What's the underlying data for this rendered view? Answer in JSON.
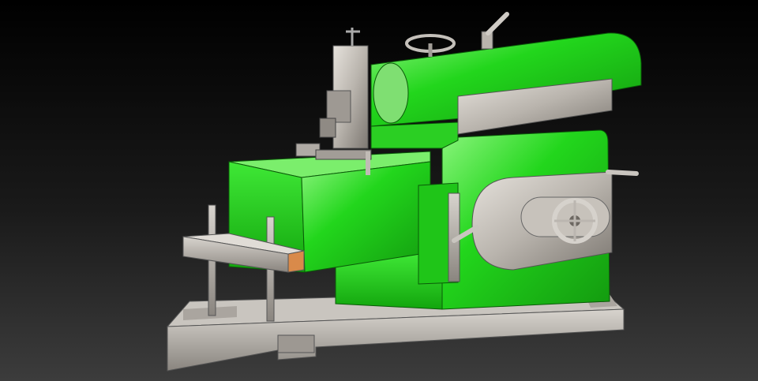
{
  "scene": {
    "subject": "shaper-machine-cad-render",
    "colors": {
      "background_top": "#000000",
      "background_bottom": "#3c3c3c",
      "body_green": "#22d61c",
      "body_green_dark": "#139a0f",
      "body_green_light": "#8cf57e",
      "steel": "#b9b4ad",
      "steel_dark": "#7d7872",
      "steel_light": "#e6e2dc",
      "workpiece_orange": "#d98a4a"
    }
  }
}
